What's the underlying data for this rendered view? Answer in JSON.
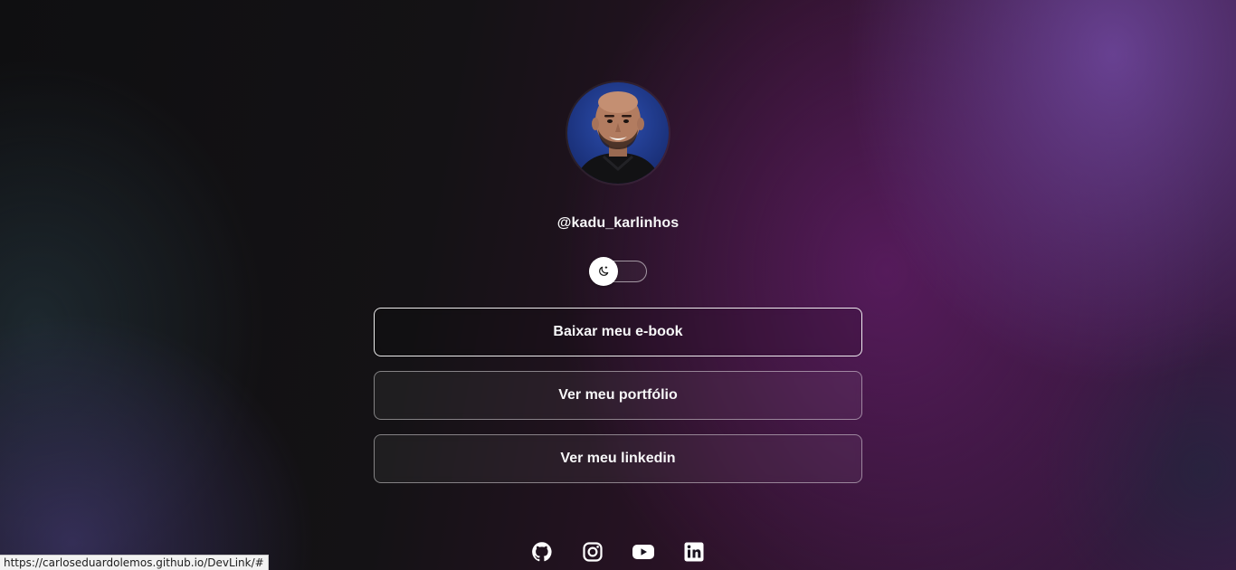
{
  "profile": {
    "handle": "@kadu_karlinhos",
    "avatar_icon": "profile-photo"
  },
  "theme_toggle": {
    "icon": "moon-icon",
    "state": "dark"
  },
  "links": [
    {
      "label": "Baixar meu e-book",
      "active": true
    },
    {
      "label": "Ver meu portfólio",
      "active": false
    },
    {
      "label": "Ver meu linkedin",
      "active": false
    }
  ],
  "socials": [
    {
      "name": "github-icon"
    },
    {
      "name": "instagram-icon"
    },
    {
      "name": "youtube-icon"
    },
    {
      "name": "linkedin-icon"
    }
  ],
  "status_bar": {
    "url": "https://carloseduardolemos.github.io/DevLink/#"
  },
  "colors": {
    "accent_purple": "#6a3aa0",
    "magenta": "#5a1a5e",
    "text": "#f7f7f8"
  }
}
